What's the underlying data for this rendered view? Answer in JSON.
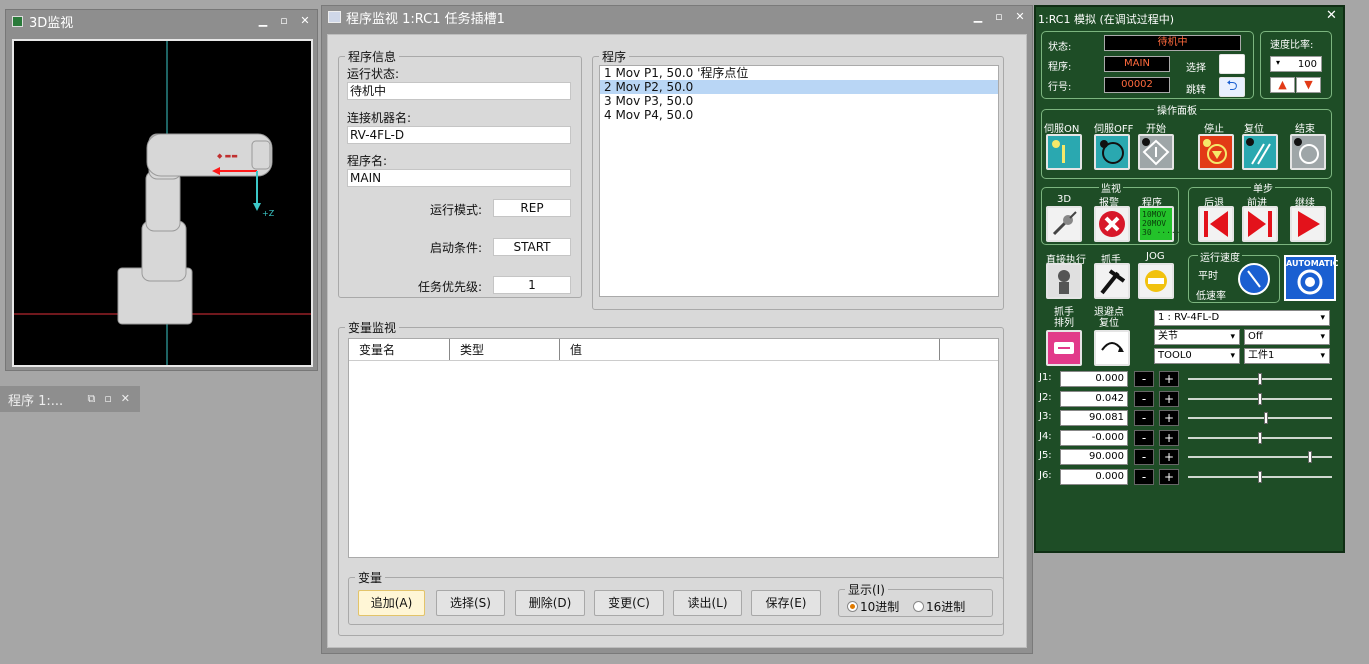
{
  "win3d": {
    "title": "3D监视",
    "axis_label": "+Z"
  },
  "prog_tab": {
    "title": "程序 1:..."
  },
  "main": {
    "title": "程序监视 1:RC1 任务插槽1",
    "info_group": "程序信息",
    "run_state_label": "运行状态:",
    "run_state_value": "待机中",
    "robot_label": "连接机器名:",
    "robot_value": "RV-4FL-D",
    "prog_name_label": "程序名:",
    "prog_name_value": "MAIN",
    "run_mode_label": "运行模式:",
    "run_mode_value": "REP",
    "start_cond_label": "启动条件:",
    "start_cond_value": "START",
    "priority_label": "任务优先级:",
    "priority_value": "1",
    "program_group": "程序",
    "program_lines": [
      "1 Mov P1, 50.0 '程序点位",
      "2 Mov P2, 50.0",
      "3 Mov P3, 50.0",
      "4 Mov P4, 50.0"
    ],
    "var_group": "变量监视",
    "var_columns": [
      "变量名",
      "类型",
      "值"
    ],
    "var_buttons_group": "变量",
    "buttons": [
      "追加(A)",
      "选择(S)",
      "删除(D)",
      "变更(C)",
      "读出(L)",
      "保存(E)"
    ],
    "display_group": "显示(I)",
    "radio_dec": "10进制",
    "radio_hex": "16进制"
  },
  "panel": {
    "title": "1:RC1 模拟 (在调试过程中)",
    "status_label": "状态:",
    "status_value": "待机中",
    "program_label": "程序:",
    "program_value": "MAIN",
    "line_label": "行号:",
    "line_value": "00002",
    "select_label": "选择",
    "jump_label": "跳转",
    "speed_label": "速度比率:",
    "speed_value": "100",
    "ops_title": "操作面板",
    "servo_on": "伺服ON",
    "servo_off": "伺服OFF",
    "start": "开始",
    "stop": "停止",
    "reset": "复位",
    "end": "结束",
    "monitor_title": "监视",
    "label_3d": "3D",
    "alarm": "报警",
    "program": "程序",
    "step_title": "单步",
    "back": "后退",
    "forward": "前进",
    "continue": "继续",
    "direct_exec": "直接执行",
    "hand": "抓手",
    "jog": "JOG",
    "run_speed_title": "运行速度",
    "smooth": "平时",
    "low_speed": "低速率",
    "automatic": "AUTOMATIC",
    "hand_arrange": "抓手\n排列",
    "retreat_reset": "退避点\n复位",
    "robot_select": "1 : RV-4FL-D",
    "joint_mode": "关节",
    "off_mode": "Off",
    "tool": "TOOL0",
    "work": "工件1",
    "prog_led": "10MOV\n20MOV\n30 ·····",
    "joints": [
      {
        "name": "J1:",
        "value": "0.000",
        "level": 0.5
      },
      {
        "name": "J2:",
        "value": "0.042",
        "level": 0.5
      },
      {
        "name": "J3:",
        "value": "90.081",
        "level": 0.54
      },
      {
        "name": "J4:",
        "value": "-0.000",
        "level": 0.5
      },
      {
        "name": "J5:",
        "value": "90.000",
        "level": 0.86
      },
      {
        "name": "J6:",
        "value": "0.000",
        "level": 0.5
      }
    ]
  },
  "colors": {
    "panel_bg": "#1e4d26",
    "selected_row": "#b9d6f5",
    "auto_blue": "#1a5fd1",
    "stop_red": "#e23a16"
  }
}
